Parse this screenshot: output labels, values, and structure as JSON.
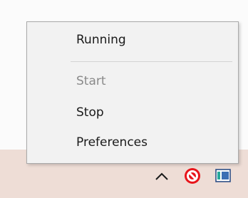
{
  "context_menu": {
    "items": [
      {
        "label": "Running",
        "enabled": true
      },
      {
        "label": "Start",
        "enabled": false
      },
      {
        "label": "Stop",
        "enabled": true
      },
      {
        "label": "Preferences",
        "enabled": true
      }
    ]
  },
  "tray": {
    "icons": [
      "show-hidden-icons-chevron-icon",
      "stop-status-icon",
      "app-window-icon"
    ],
    "colors": {
      "taskbar": "#eeddd6",
      "stop_icon": "#e8151b",
      "app_icon_teal": "#28a89b",
      "app_icon_blue": "#3a6fb4"
    }
  }
}
